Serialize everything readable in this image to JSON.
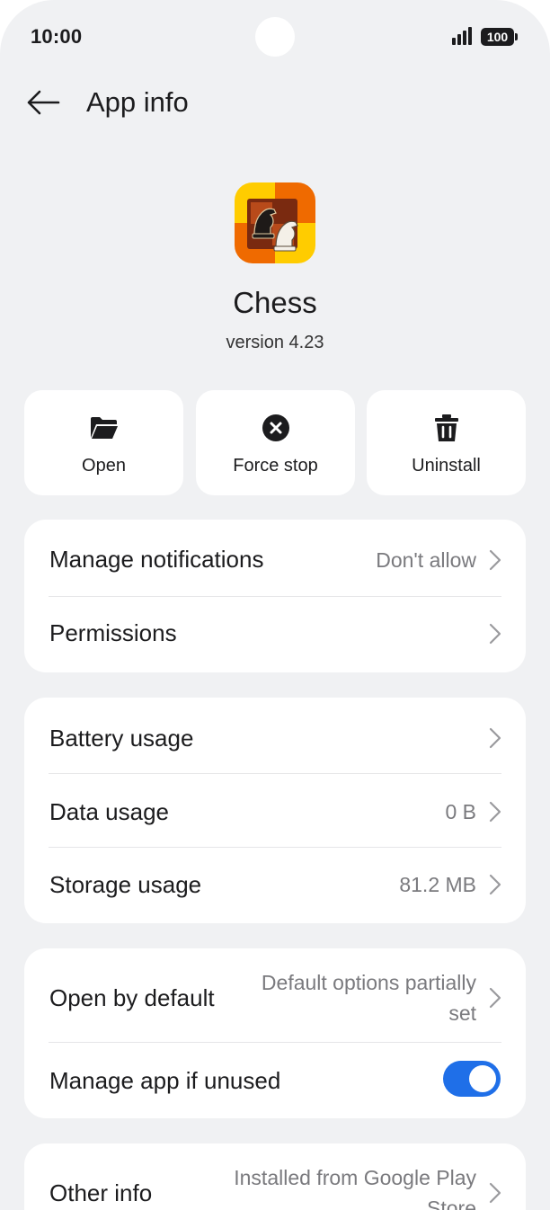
{
  "status_bar": {
    "time": "10:00",
    "battery": "100"
  },
  "header": {
    "title": "App info"
  },
  "app": {
    "name": "Chess",
    "version": "version 4.23"
  },
  "actions": [
    {
      "label": "Open",
      "icon": "folder-open-icon"
    },
    {
      "label": "Force stop",
      "icon": "close-circle-icon"
    },
    {
      "label": "Uninstall",
      "icon": "trash-icon"
    }
  ],
  "sections": {
    "notifications": {
      "manage_notifications": {
        "title": "Manage notifications",
        "value": "Don't allow"
      },
      "permissions": {
        "title": "Permissions"
      }
    },
    "usage": {
      "battery": {
        "title": "Battery usage"
      },
      "data": {
        "title": "Data usage",
        "value": "0 B"
      },
      "storage": {
        "title": "Storage usage",
        "value": "81.2 MB"
      }
    },
    "defaults": {
      "open_by_default": {
        "title": "Open by default",
        "value_line1": "Default options partially",
        "value_line2": "set"
      },
      "manage_if_unused": {
        "title": "Manage app if unused",
        "toggle_on": true
      }
    },
    "other": {
      "other_info": {
        "title": "Other info",
        "value_line1": "Installed from Google Play",
        "value_line2": "Store"
      }
    }
  },
  "colors": {
    "background": "#f0f1f3",
    "card": "#ffffff",
    "accent": "#1f6fe8",
    "secondary_text": "#7a7a7e"
  }
}
